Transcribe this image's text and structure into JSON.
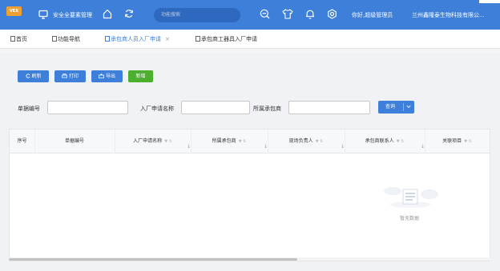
{
  "header": {
    "logo": "VEX",
    "system_title": "安全全要素管理",
    "search_placeholder": "功能搜索",
    "greeting": "你好,超级管理员",
    "company": "兰州鑫隆泰生物科技有限公..."
  },
  "tabs": [
    {
      "label": "首页"
    },
    {
      "label": "功能导航"
    },
    {
      "label": "承包商人员入厂申请",
      "active": true
    },
    {
      "label": "承包商工器具入厂申请"
    }
  ],
  "tab_close": "×",
  "toolbar": {
    "refresh": "刷新",
    "print": "打印",
    "export": "导出",
    "add": "新增"
  },
  "filters": {
    "doc_no_label": "单据编号",
    "entry_name_label": "入厂申请名称",
    "contractor_label": "所属承包商",
    "query_label": "查询"
  },
  "table": {
    "columns": [
      "序号",
      "单据编号",
      "入厂申请名称",
      "所属承包商",
      "现场负责人",
      "承包商联系人",
      "关联项目"
    ],
    "empty_text": "暂无数据"
  },
  "colors": {
    "primary": "#3d7fd9",
    "success": "#4caf2e",
    "logo": "#f0a030"
  }
}
